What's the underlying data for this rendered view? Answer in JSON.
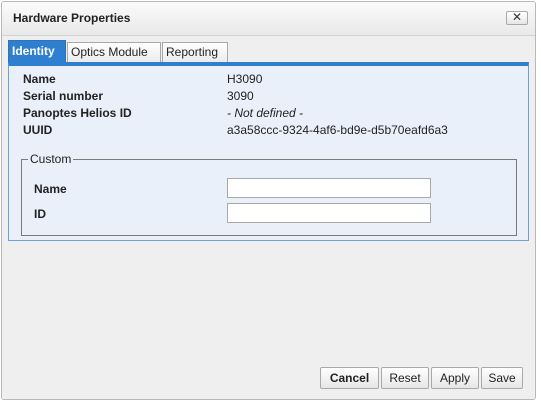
{
  "dialog": {
    "title": "Hardware Properties",
    "close_label": "✕"
  },
  "tabs": [
    {
      "label": "Identity",
      "active": true
    },
    {
      "label": "Optics Module",
      "active": false
    },
    {
      "label": "Reporting",
      "active": false
    }
  ],
  "identity": {
    "properties": [
      {
        "label": "Name",
        "value": "H3090"
      },
      {
        "label": "Serial number",
        "value": "3090"
      },
      {
        "label": "Panoptes Helios ID",
        "value": "- Not defined -"
      },
      {
        "label": "UUID",
        "value": "a3a58ccc-9324-4af6-bd9e-d5b70eafd6a3"
      }
    ],
    "custom": {
      "legend": "Custom",
      "fields": [
        {
          "label": "Name",
          "value": ""
        },
        {
          "label": "ID",
          "value": ""
        }
      ]
    }
  },
  "footer": {
    "cancel": "Cancel",
    "reset": "Reset",
    "apply": "Apply",
    "save": "Save"
  },
  "colors": {
    "accent": "#2f7fd0",
    "panel_bg": "#eaf0fa",
    "content_bg": "#efefef"
  }
}
